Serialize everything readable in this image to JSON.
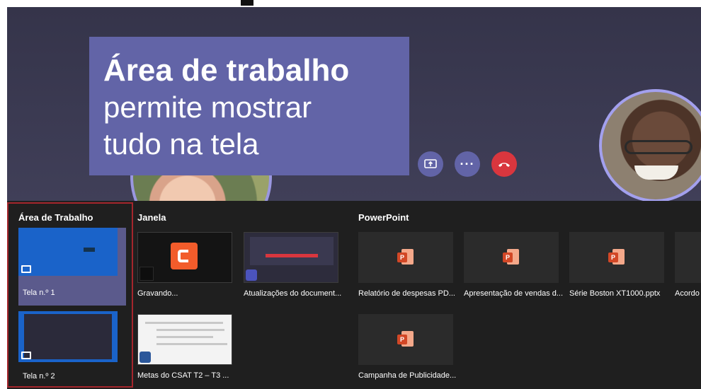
{
  "caption": {
    "line1": "Área de trabalho",
    "line2": "permite mostrar",
    "line3": "tudo na tela"
  },
  "controls": {
    "more_glyph": "···"
  },
  "tray": {
    "desktop": {
      "title": "Área de Trabalho",
      "screens": [
        {
          "label": "Tela n.º 1"
        },
        {
          "label": "Tela n.º 2"
        }
      ]
    },
    "window": {
      "title": "Janela",
      "items": [
        {
          "label": "Gravando..."
        },
        {
          "label": "Atualizações do document..."
        },
        {
          "label": "Metas do CSAT T2 – T3 ..."
        }
      ]
    },
    "powerpoint": {
      "title": "PowerPoint",
      "badge": "P",
      "items": [
        {
          "label": "Relatório de despesas PD..."
        },
        {
          "label": "Apresentação de vendas d..."
        },
        {
          "label": "Série Boston XT1000.pptx"
        },
        {
          "label": "Acordo"
        },
        {
          "label": "Campanha de Publicidade..."
        }
      ]
    }
  },
  "colors": {
    "accent": "#6264a7",
    "hangup": "#d9363e",
    "selection_border": "#a4262c",
    "tray_background": "#1f1f1f"
  }
}
